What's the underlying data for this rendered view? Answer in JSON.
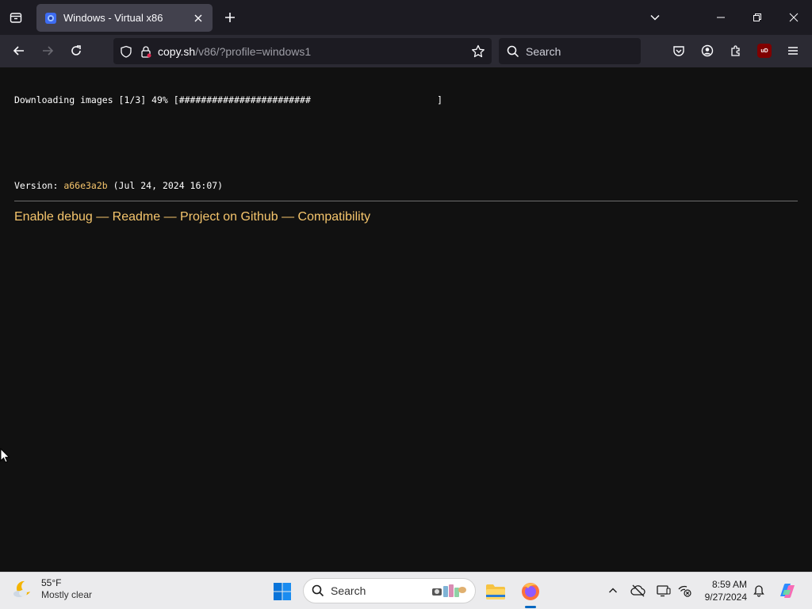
{
  "browser": {
    "tab": {
      "title": "Windows - Virtual x86"
    },
    "url": {
      "host": "copy.sh",
      "path": "/v86/?profile=windows1"
    },
    "search": {
      "placeholder": "Search"
    },
    "extension_badge": "uD"
  },
  "page": {
    "download_line": "Downloading images [1/3] 49% [########################                       ]",
    "version_label": "Version: ",
    "version_hash": "a66e3a2b",
    "version_date": " (Jul 24, 2024 16:07)",
    "progress": {
      "current_image": 1,
      "total_images": 3,
      "percent": 49
    },
    "links": [
      {
        "label": "Enable debug"
      },
      {
        "label": "Readme"
      },
      {
        "label": "Project on Github"
      },
      {
        "label": "Compatibility"
      }
    ],
    "separator": " — "
  },
  "taskbar": {
    "weather": {
      "temp": "55°F",
      "desc": "Mostly clear"
    },
    "search_placeholder": "Search",
    "clock": {
      "time": "8:59 AM",
      "date": "9/27/2024"
    }
  },
  "colors": {
    "link": "#f5c56c",
    "page_bg": "#111111",
    "tab_active": "#42414d",
    "toolbar": "#2b2a33"
  }
}
